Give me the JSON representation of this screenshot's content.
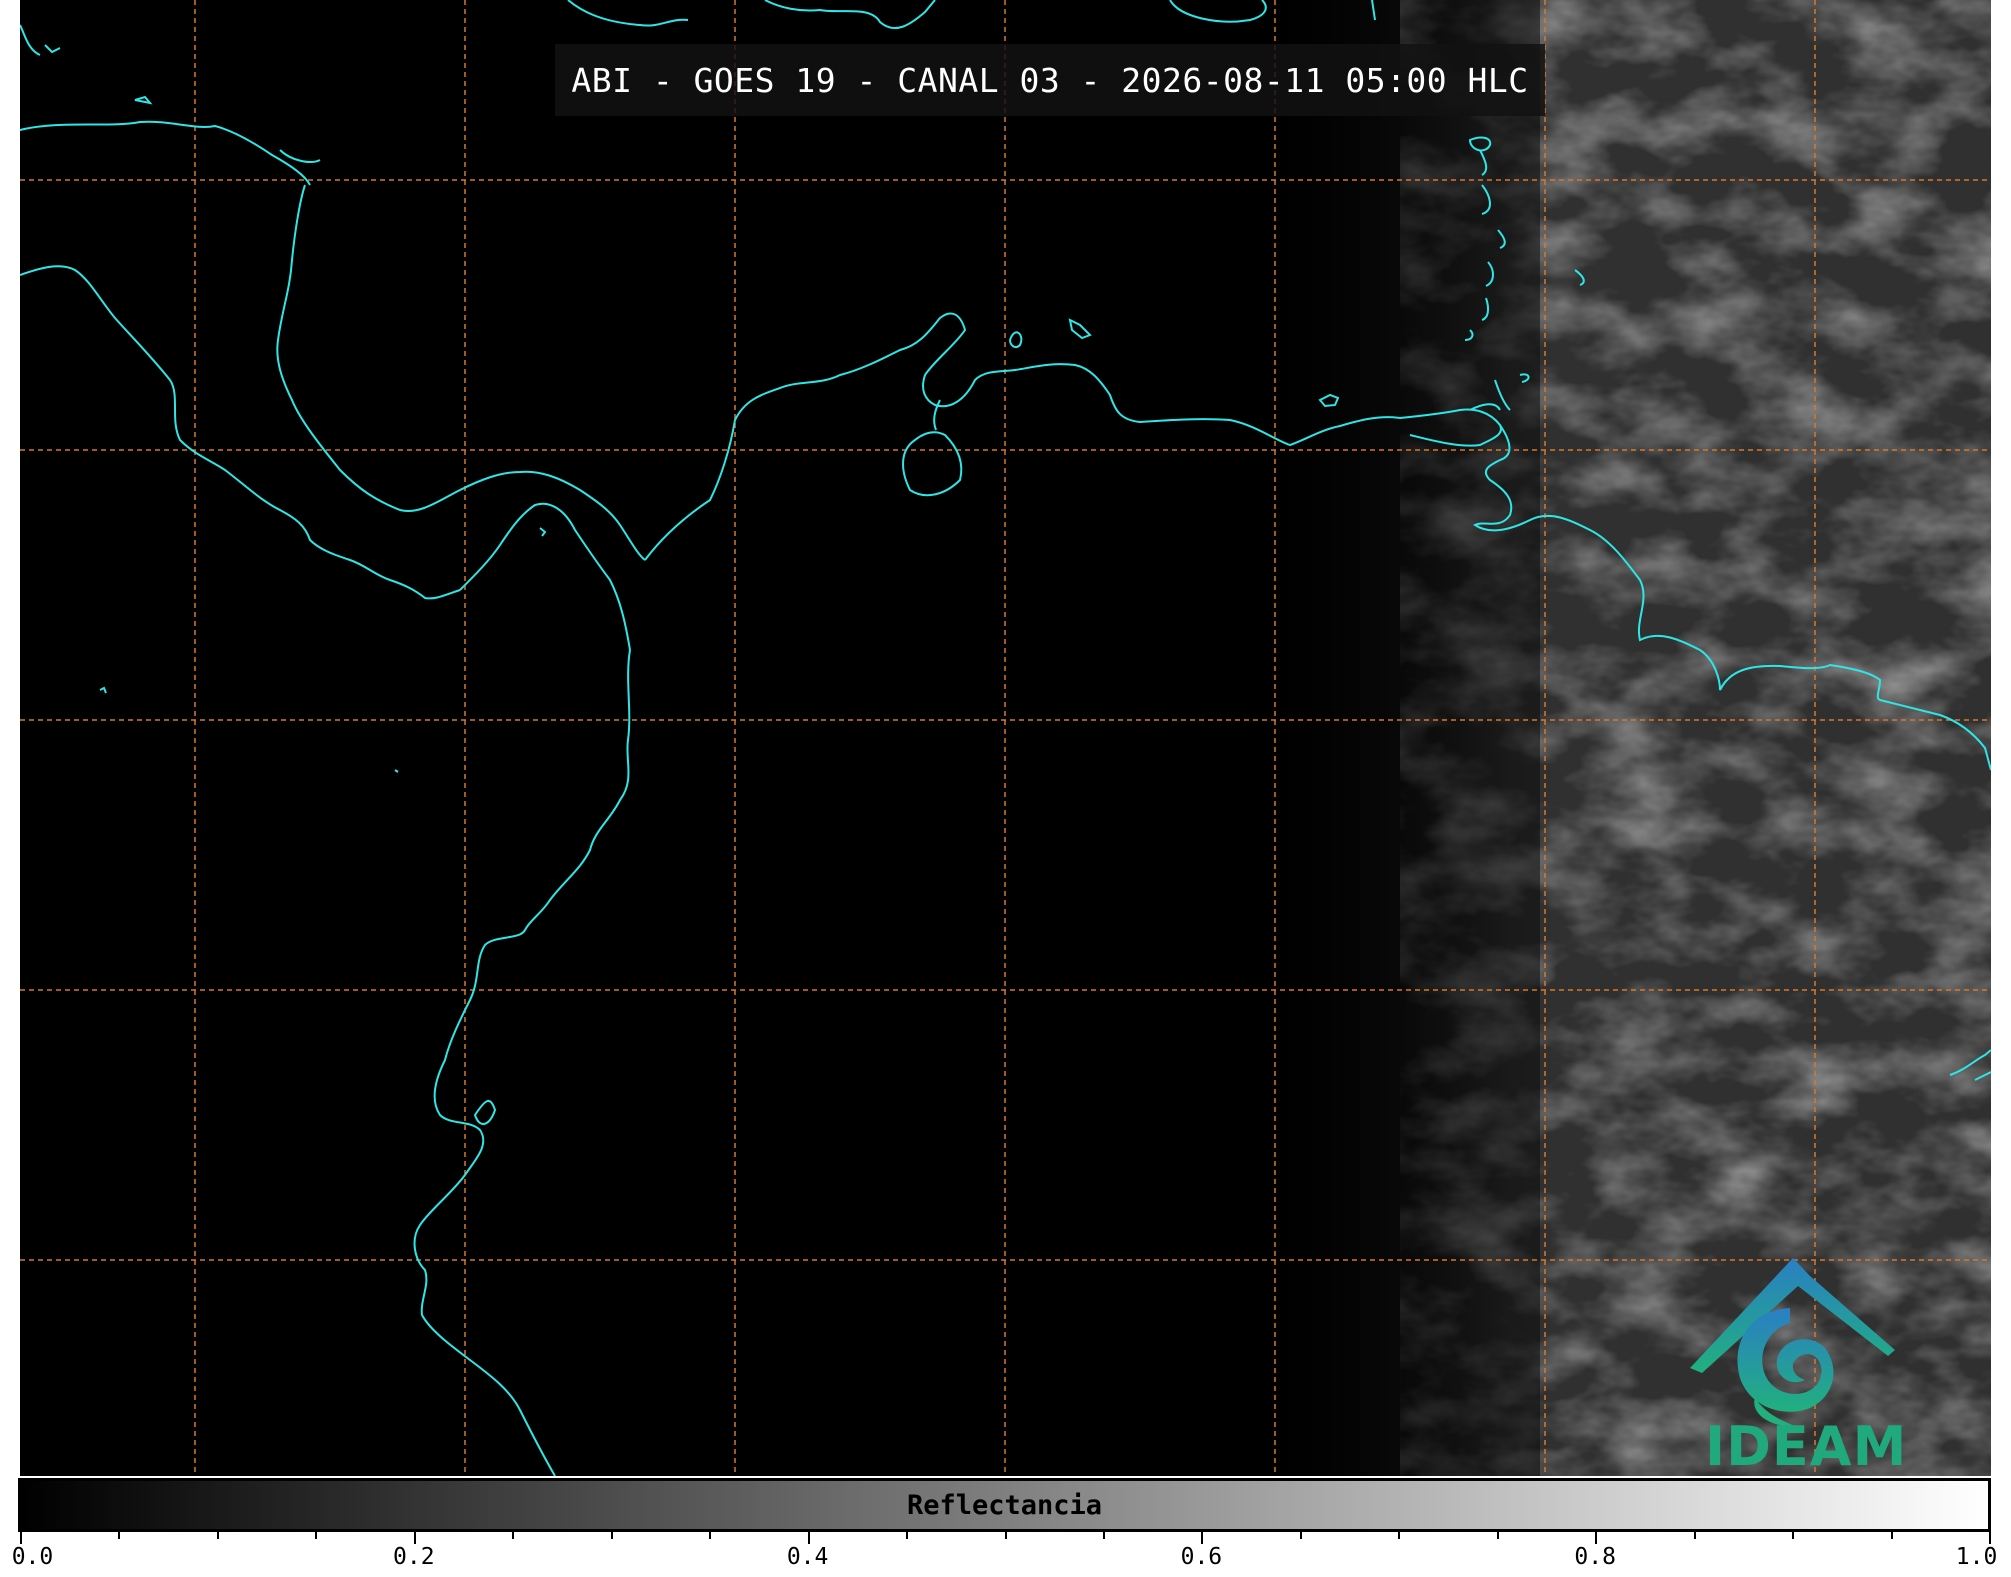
{
  "map": {
    "title": "ABI - GOES 19 - CANAL 03 - 2026-08-11 05:00 HLC",
    "coastline_color": "#2ee6e6",
    "grid_color": "#d9782b",
    "grid_style": "dashed",
    "background": "night (black) on west, daylight grayscale reflectance on east"
  },
  "logo": {
    "text": "IDEAM",
    "icon": "ideam-mountain-swirl-logo",
    "color_top": "#2a7fc4",
    "color_bottom": "#21b07e"
  },
  "colorbar": {
    "label": "Reflectancia",
    "min": 0.0,
    "max": 1.0,
    "gradient": [
      "#000000",
      "#ffffff"
    ],
    "tick_labels": [
      "0.0",
      "0.2",
      "0.4",
      "0.6",
      "0.8",
      "1.0"
    ],
    "tick_values": [
      0.0,
      0.2,
      0.4,
      0.6,
      0.8,
      1.0
    ],
    "minor_step": 0.05
  }
}
